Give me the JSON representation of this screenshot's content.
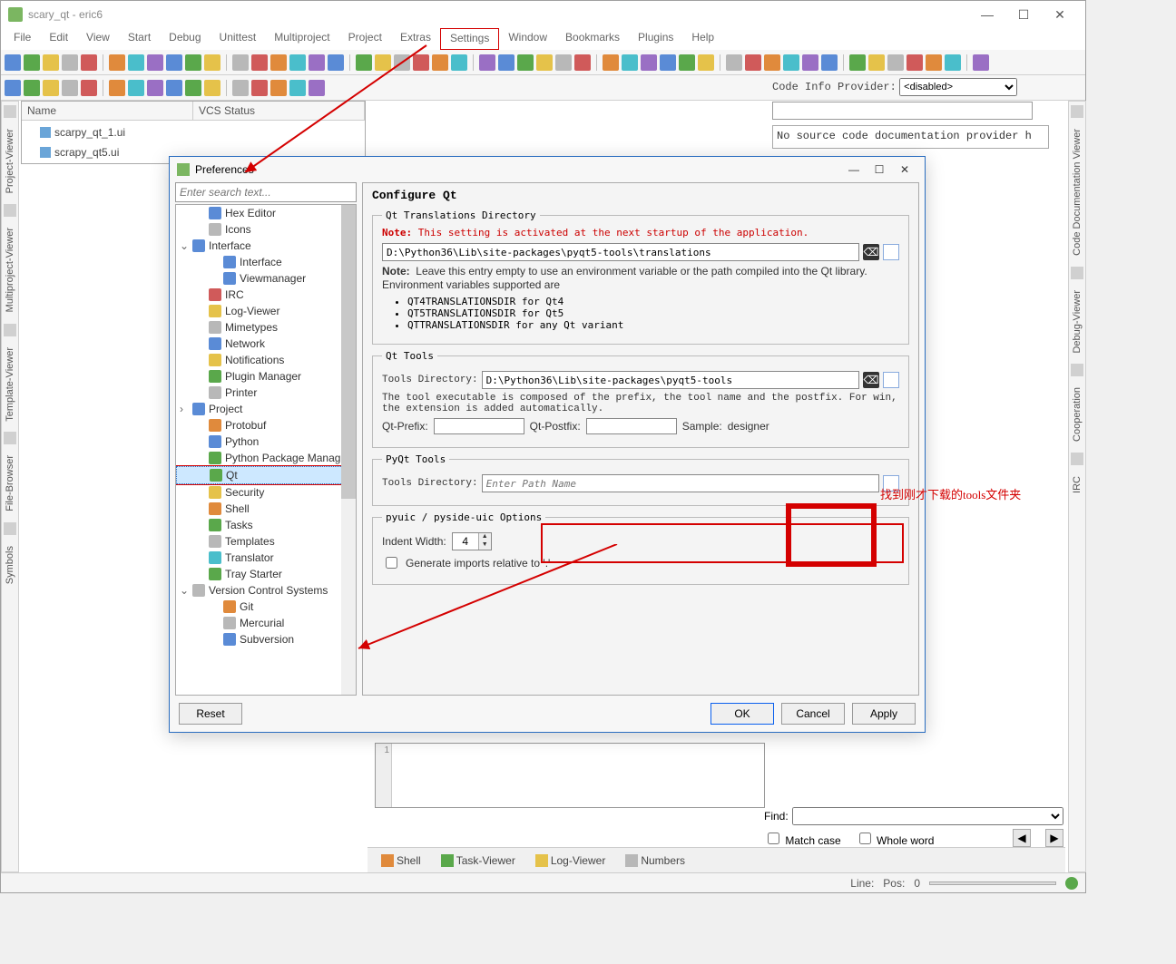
{
  "window": {
    "title": "scary_qt - eric6"
  },
  "menu": {
    "items": [
      "File",
      "Edit",
      "View",
      "Start",
      "Debug",
      "Unittest",
      "Multiproject",
      "Project",
      "Extras",
      "Settings",
      "Window",
      "Bookmarks",
      "Plugins",
      "Help"
    ]
  },
  "left_tabs": [
    "Project-Viewer",
    "Multiproject-Viewer",
    "Template-Viewer",
    "File-Browser",
    "Symbols"
  ],
  "right_tabs": [
    "Code Documentation Viewer",
    "Debug-Viewer",
    "Cooperation",
    "IRC"
  ],
  "project": {
    "columns": [
      "Name",
      "VCS Status"
    ],
    "files": [
      "scarpy_qt_1.ui",
      "scrapy_qt5.ui"
    ]
  },
  "code_info": {
    "label": "Code Info Provider:",
    "selected": "<disabled>",
    "doc_placeholder": "No source code documentation provider h"
  },
  "bottom_tabs": [
    "Shell",
    "Task-Viewer",
    "Log-Viewer",
    "Numbers"
  ],
  "find": {
    "label": "Find:",
    "match_case": "Match case",
    "whole_word": "Whole word"
  },
  "status": {
    "line": "Line:",
    "pos": "Pos:",
    "zero": "0"
  },
  "shell_line": "1",
  "dialog": {
    "title": "Preferences",
    "search_placeholder": "Enter search text...",
    "tree": [
      {
        "d": 2,
        "label": "Hex Editor",
        "c": "c-bl"
      },
      {
        "d": 2,
        "label": "Icons",
        "c": "c-gy"
      },
      {
        "d": 1,
        "label": "Interface",
        "c": "c-bl",
        "exp": "⌄"
      },
      {
        "d": 3,
        "label": "Interface",
        "c": "c-bl"
      },
      {
        "d": 3,
        "label": "Viewmanager",
        "c": "c-bl"
      },
      {
        "d": 2,
        "label": "IRC",
        "c": "c-rd"
      },
      {
        "d": 2,
        "label": "Log-Viewer",
        "c": "c-yl"
      },
      {
        "d": 2,
        "label": "Mimetypes",
        "c": "c-gy"
      },
      {
        "d": 2,
        "label": "Network",
        "c": "c-bl"
      },
      {
        "d": 2,
        "label": "Notifications",
        "c": "c-yl"
      },
      {
        "d": 2,
        "label": "Plugin Manager",
        "c": "c-gr"
      },
      {
        "d": 2,
        "label": "Printer",
        "c": "c-gy"
      },
      {
        "d": 1,
        "label": "Project",
        "c": "c-bl",
        "exp": "›"
      },
      {
        "d": 2,
        "label": "Protobuf",
        "c": "c-or"
      },
      {
        "d": 2,
        "label": "Python",
        "c": "c-bl"
      },
      {
        "d": 2,
        "label": "Python Package Manag...",
        "c": "c-gr"
      },
      {
        "d": 2,
        "label": "Qt",
        "c": "c-gr",
        "sel": true,
        "hl": true
      },
      {
        "d": 2,
        "label": "Security",
        "c": "c-yl"
      },
      {
        "d": 2,
        "label": "Shell",
        "c": "c-or"
      },
      {
        "d": 2,
        "label": "Tasks",
        "c": "c-gr"
      },
      {
        "d": 2,
        "label": "Templates",
        "c": "c-gy"
      },
      {
        "d": 2,
        "label": "Translator",
        "c": "c-cy"
      },
      {
        "d": 2,
        "label": "Tray Starter",
        "c": "c-gr"
      },
      {
        "d": 1,
        "label": "Version Control Systems",
        "c": "c-gy",
        "exp": "⌄"
      },
      {
        "d": 3,
        "label": "Git",
        "c": "c-or"
      },
      {
        "d": 3,
        "label": "Mercurial",
        "c": "c-gy"
      },
      {
        "d": 3,
        "label": "Subversion",
        "c": "c-bl"
      }
    ],
    "page_title": "Configure Qt",
    "sections": {
      "trans": {
        "legend": "Qt Translations Directory",
        "note_bold": "Note:",
        "note_red": "This setting is activated at the next startup of the application.",
        "path": "D:\\Python36\\Lib\\site-packages\\pyqt5-tools\\translations",
        "note2_bold": "Note:",
        "note2": "Leave this entry empty to use an environment variable or the path compiled into the Qt library. Environment variables supported are",
        "bullets": [
          "QT4TRANSLATIONSDIR for Qt4",
          "QT5TRANSLATIONSDIR for Qt5",
          "QTTRANSLATIONSDIR for any Qt variant"
        ]
      },
      "tools": {
        "legend": "Qt Tools",
        "tools_dir_lbl": "Tools Directory:",
        "tools_dir": "D:\\Python36\\Lib\\site-packages\\pyqt5-tools",
        "desc": "The tool executable is composed of the prefix, the tool name and the postfix. For win, the extension is added automatically.",
        "prefix_lbl": "Qt-Prefix:",
        "postfix_lbl": "Qt-Postfix:",
        "sample_lbl": "Sample:",
        "sample_val": "designer"
      },
      "pyqt": {
        "legend": "PyQt Tools",
        "dir_lbl": "Tools Directory:",
        "placeholder": "Enter Path Name"
      },
      "pyuic": {
        "legend": "pyuic / pyside-uic Options",
        "indent_lbl": "Indent Width:",
        "indent_val": "4",
        "gen_rel": "Generate imports relative to '.'"
      }
    },
    "buttons": {
      "reset": "Reset",
      "ok": "OK",
      "cancel": "Cancel",
      "apply": "Apply"
    }
  },
  "annotation_text": "找到刚才下载的tools文件夹"
}
